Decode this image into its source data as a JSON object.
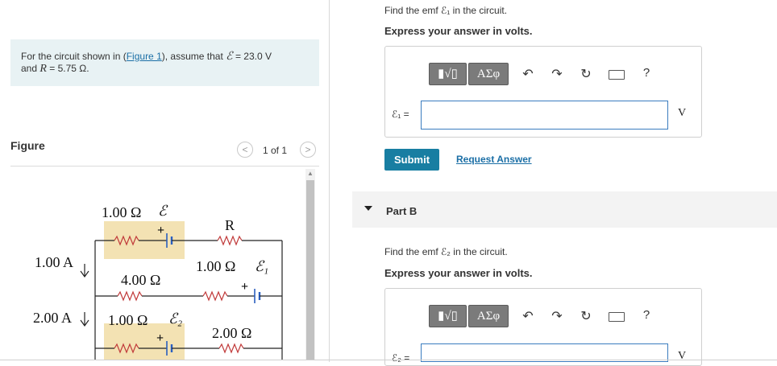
{
  "problem": {
    "prefix": "For the circuit shown in (",
    "figure_link": "Figure 1",
    "middle": "), assume that ",
    "emf_symbol": "ℰ",
    "emf_eq": " = 23.0 V",
    "line2_prefix": "and ",
    "R_symbol": "R",
    "R_eq": " = 5.75 Ω."
  },
  "figure": {
    "title": "Figure",
    "pager": "1 of 1",
    "prev_icon": "chevron-left",
    "next_icon": "chevron-right",
    "labels": {
      "top_resistor": "1.00 Ω",
      "top_emf": "ℰ",
      "R": "R",
      "current1": "1.00 A",
      "mid_resistor": "4.00 Ω",
      "e1_resistor": "1.00 Ω",
      "e1": "ℰ₁",
      "current2": "2.00 A",
      "e2_resistor": "1.00 Ω",
      "e2": "ℰ₂",
      "bottom_resistor": "2.00 Ω",
      "plus": "+"
    },
    "highlight_color": "#f3e2b3"
  },
  "partA": {
    "question": "Find the emf ℰ₁ in the circuit.",
    "instruction": "Express your answer in volts.",
    "toolbar": {
      "template_label": "▮√▯",
      "symbols_label": "ΑΣφ",
      "undo_icon": "undo-icon",
      "redo_icon": "redo-icon",
      "reset_icon": "reset-icon",
      "keyboard_icon": "keyboard-icon",
      "help_label": "?"
    },
    "variable_label": "ℰ₁ =",
    "input_value": "",
    "unit": "V",
    "submit_label": "Submit",
    "request_label": "Request Answer"
  },
  "partB": {
    "title": "Part B",
    "question": "Find the emf ℰ₂ in the circuit.",
    "instruction": "Express your answer in volts.",
    "toolbar": {
      "template_label": "▮√▯",
      "symbols_label": "ΑΣφ",
      "help_label": "?"
    },
    "variable_label": "ℰ₂ =",
    "unit": "V"
  },
  "colors": {
    "accent": "#187ea2",
    "link": "#1b6fa6",
    "problem_bg": "#e8f2f4"
  }
}
